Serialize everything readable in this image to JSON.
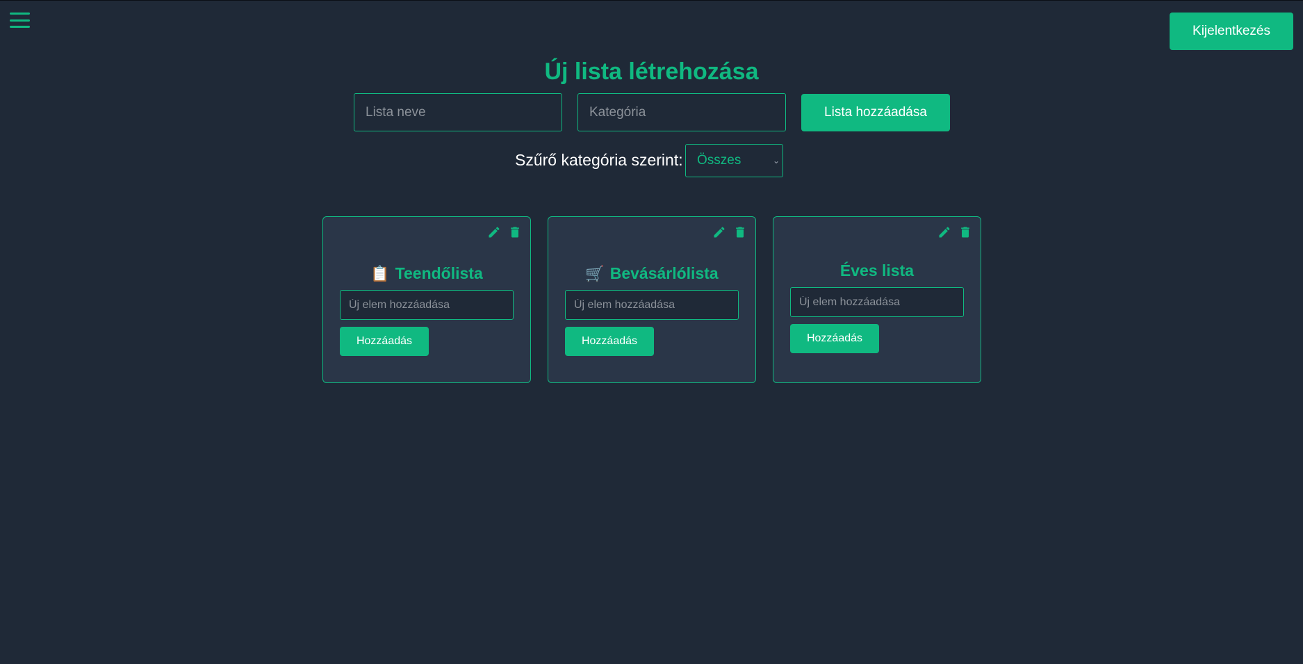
{
  "header": {
    "menu_icon": "hamburger-menu-icon",
    "logout_label": "Kijelentkezés"
  },
  "create": {
    "title": "Új lista létrehozása",
    "name_placeholder": "Lista neve",
    "category_placeholder": "Kategória",
    "add_button": "Lista hozzáadása"
  },
  "filter": {
    "label": "Szűrő kategória szerint:",
    "selected": "Összes"
  },
  "colors": {
    "accent": "#10b981",
    "background": "#1f2937",
    "card_background": "#2a3648"
  },
  "lists": [
    {
      "emoji": "📋",
      "title": "Teendőlista",
      "item_placeholder": "Új elem hozzáadása",
      "add_label": "Hozzáadás"
    },
    {
      "emoji": "🛒",
      "title": "Bevásárlólista",
      "item_placeholder": "Új elem hozzáadása",
      "add_label": "Hozzáadás"
    },
    {
      "emoji": "",
      "title": "Éves lista",
      "item_placeholder": "Új elem hozzáadása",
      "add_label": "Hozzáadás"
    }
  ]
}
